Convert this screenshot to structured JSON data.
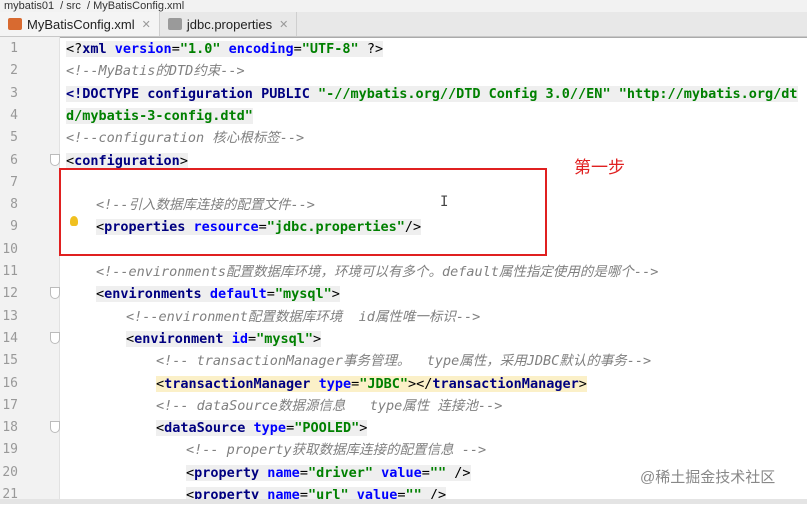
{
  "breadcrumb": [
    "mybatis01",
    "src",
    "MyBatisConfig.xml"
  ],
  "tabs": [
    {
      "label": "MyBatisConfig.xml",
      "active": true,
      "color": "#d86a30"
    },
    {
      "label": "jdbc.properties",
      "active": false,
      "color": "#9a9a9a"
    }
  ],
  "annotation": {
    "label": "第一步",
    "color": "#e02020"
  },
  "watermark": "@稀土掘金技术社区",
  "lines": [
    {
      "n": "1",
      "indent": 0,
      "bg": "hl",
      "tokens": [
        [
          "p",
          "<?"
        ],
        [
          "tag",
          "xml "
        ],
        [
          "attr",
          "version"
        ],
        [
          "p",
          "="
        ],
        [
          "val",
          "\"1.0\" "
        ],
        [
          "attr",
          "encoding"
        ],
        [
          "p",
          "="
        ],
        [
          "val",
          "\"UTF-8\" "
        ],
        [
          "p",
          "?>"
        ]
      ]
    },
    {
      "n": "2",
      "indent": 0,
      "tokens": [
        [
          "cmt",
          "<!--MyBatis的DTD约束-->"
        ]
      ]
    },
    {
      "n": "3",
      "indent": 0,
      "bg": "hl",
      "tokens": [
        [
          "tag",
          "<!DOCTYPE configuration PUBLIC "
        ],
        [
          "val",
          "\"-//mybatis.org//DTD Config 3.0//EN\" \"http://mybatis.org/dtd/mybatis-3-config.dtd\""
        ]
      ]
    },
    {
      "n": "4",
      "indent": 0,
      "tokens": []
    },
    {
      "n": "5",
      "indent": 0,
      "tokens": [
        [
          "cmt",
          "<!--configuration 核心根标签-->"
        ]
      ]
    },
    {
      "n": "6",
      "indent": 0,
      "fold": true,
      "bg": "hl",
      "tokens": [
        [
          "p",
          "<"
        ],
        [
          "tag",
          "configuration"
        ],
        [
          "p",
          ">"
        ]
      ]
    },
    {
      "n": "7",
      "indent": 0,
      "tokens": []
    },
    {
      "n": "8",
      "indent": 1,
      "tokens": [
        [
          "cmt",
          "<!--引入数据库连接的配置文件-->"
        ]
      ]
    },
    {
      "n": "9",
      "indent": 1,
      "bg": "hl",
      "tokens": [
        [
          "p",
          "<"
        ],
        [
          "tag",
          "properties "
        ],
        [
          "attr",
          "resource"
        ],
        [
          "p",
          "="
        ],
        [
          "val",
          "\"jdbc.properties\""
        ],
        [
          "p",
          "/>"
        ]
      ]
    },
    {
      "n": "10",
      "indent": 0,
      "tokens": []
    },
    {
      "n": "11",
      "indent": 1,
      "tokens": [
        [
          "cmt",
          "<!--environments配置数据库环境，环境可以有多个。default属性指定使用的是哪个-->"
        ]
      ]
    },
    {
      "n": "12",
      "indent": 1,
      "fold": true,
      "bg": "hl",
      "tokens": [
        [
          "p",
          "<"
        ],
        [
          "tag",
          "environments "
        ],
        [
          "attr",
          "default"
        ],
        [
          "p",
          "="
        ],
        [
          "val",
          "\"mysql\""
        ],
        [
          "p",
          ">"
        ]
      ]
    },
    {
      "n": "13",
      "indent": 2,
      "tokens": [
        [
          "cmt",
          "<!--environment配置数据库环境  id属性唯一标识-->"
        ]
      ]
    },
    {
      "n": "14",
      "indent": 2,
      "fold": true,
      "bg": "hl",
      "tokens": [
        [
          "p",
          "<"
        ],
        [
          "tag",
          "environment "
        ],
        [
          "attr",
          "id"
        ],
        [
          "p",
          "="
        ],
        [
          "val",
          "\"mysql\""
        ],
        [
          "p",
          ">"
        ]
      ]
    },
    {
      "n": "15",
      "indent": 3,
      "tokens": [
        [
          "cmt",
          "<!-- transactionManager事务管理。  type属性，采用JDBC默认的事务-->"
        ]
      ]
    },
    {
      "n": "16",
      "indent": 3,
      "bg": "ylw",
      "tokens": [
        [
          "p",
          "<"
        ],
        [
          "tag",
          "transactionManager "
        ],
        [
          "attr",
          "type"
        ],
        [
          "p",
          "="
        ],
        [
          "val",
          "\"JDBC\""
        ],
        [
          "p",
          "></"
        ],
        [
          "tag",
          "transactionManager"
        ],
        [
          "p",
          ">"
        ]
      ]
    },
    {
      "n": "17",
      "indent": 3,
      "tokens": [
        [
          "cmt",
          "<!-- dataSource数据源信息   type属性 连接池-->"
        ]
      ]
    },
    {
      "n": "18",
      "indent": 3,
      "fold": true,
      "bg": "hl",
      "tokens": [
        [
          "p",
          "<"
        ],
        [
          "tag",
          "dataSource "
        ],
        [
          "attr",
          "type"
        ],
        [
          "p",
          "="
        ],
        [
          "val",
          "\"POOLED\""
        ],
        [
          "p",
          ">"
        ]
      ]
    },
    {
      "n": "19",
      "indent": 4,
      "tokens": [
        [
          "cmt",
          "<!-- property获取数据库连接的配置信息 -->"
        ]
      ]
    },
    {
      "n": "20",
      "indent": 4,
      "bg": "hl",
      "tokens": [
        [
          "p",
          "<"
        ],
        [
          "tag",
          "property "
        ],
        [
          "attr",
          "name"
        ],
        [
          "p",
          "="
        ],
        [
          "val",
          "\"driver\" "
        ],
        [
          "attr",
          "value"
        ],
        [
          "p",
          "="
        ],
        [
          "val",
          "\"\" "
        ],
        [
          "p",
          "/>"
        ]
      ]
    },
    {
      "n": "21",
      "indent": 4,
      "bg": "hl",
      "tokens": [
        [
          "p",
          "<"
        ],
        [
          "tag",
          "property "
        ],
        [
          "attr",
          "name"
        ],
        [
          "p",
          "="
        ],
        [
          "val",
          "\"url\" "
        ],
        [
          "attr",
          "value"
        ],
        [
          "p",
          "="
        ],
        [
          "val",
          "\"\" "
        ],
        [
          "p",
          "/>"
        ]
      ]
    }
  ]
}
